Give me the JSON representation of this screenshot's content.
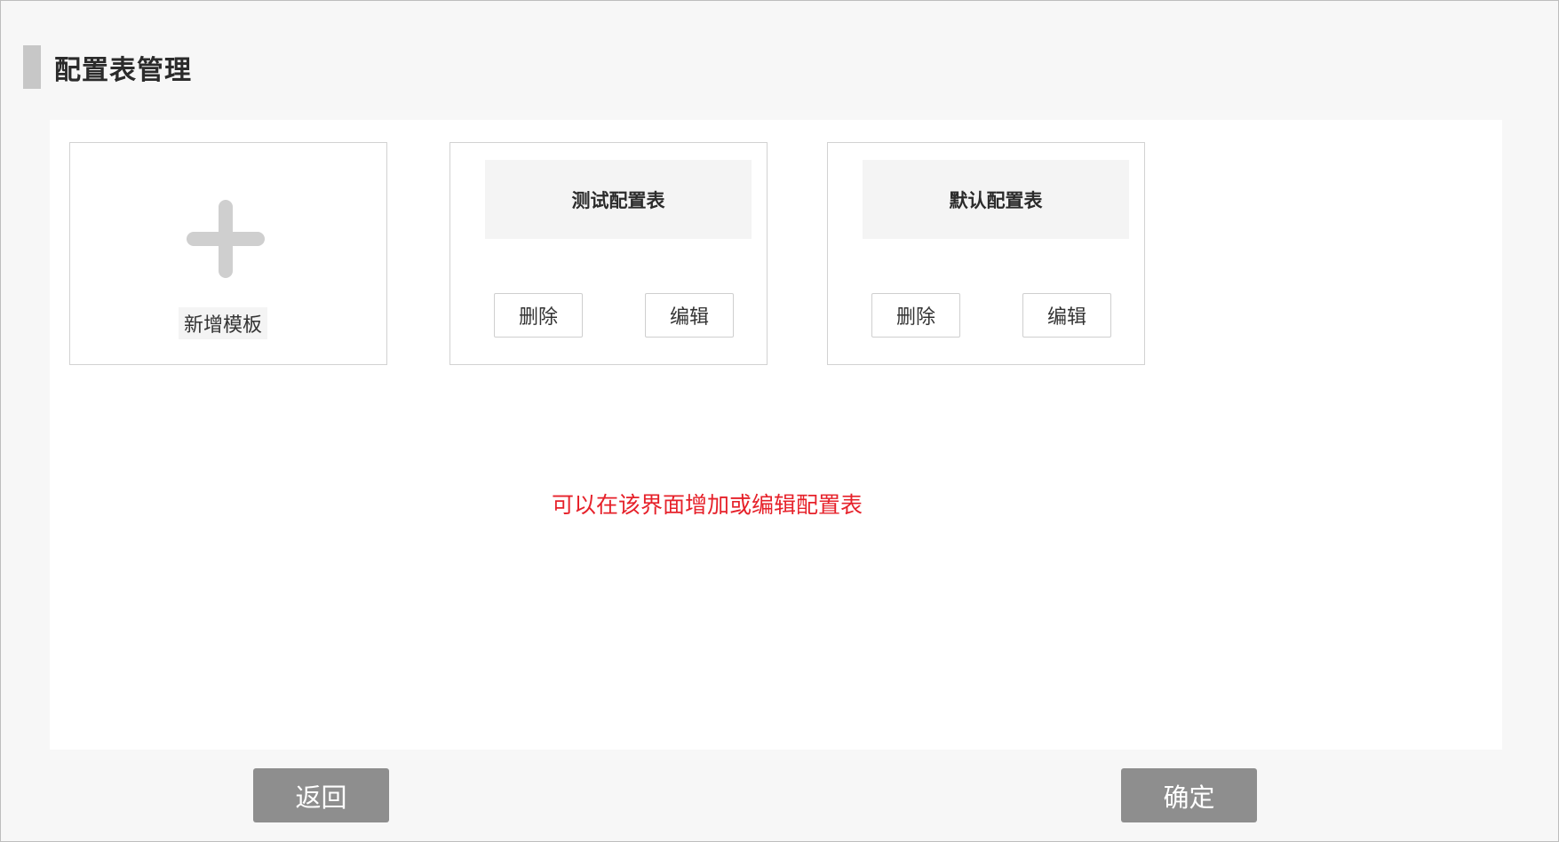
{
  "page": {
    "title": "配置表管理"
  },
  "add_card": {
    "label": "新增模板",
    "icon": "plus-icon"
  },
  "cards": [
    {
      "name": "测试配置表",
      "delete_label": "删除",
      "edit_label": "编辑"
    },
    {
      "name": "默认配置表",
      "delete_label": "删除",
      "edit_label": "编辑"
    }
  ],
  "hint": "可以在该界面增加或编辑配置表",
  "footer": {
    "back_label": "返回",
    "confirm_label": "确定"
  },
  "colors": {
    "hint": "#e6212a",
    "footer_button": "#8e8e8e",
    "title_marker": "#c7c7c7",
    "background": "#f7f7f7"
  }
}
